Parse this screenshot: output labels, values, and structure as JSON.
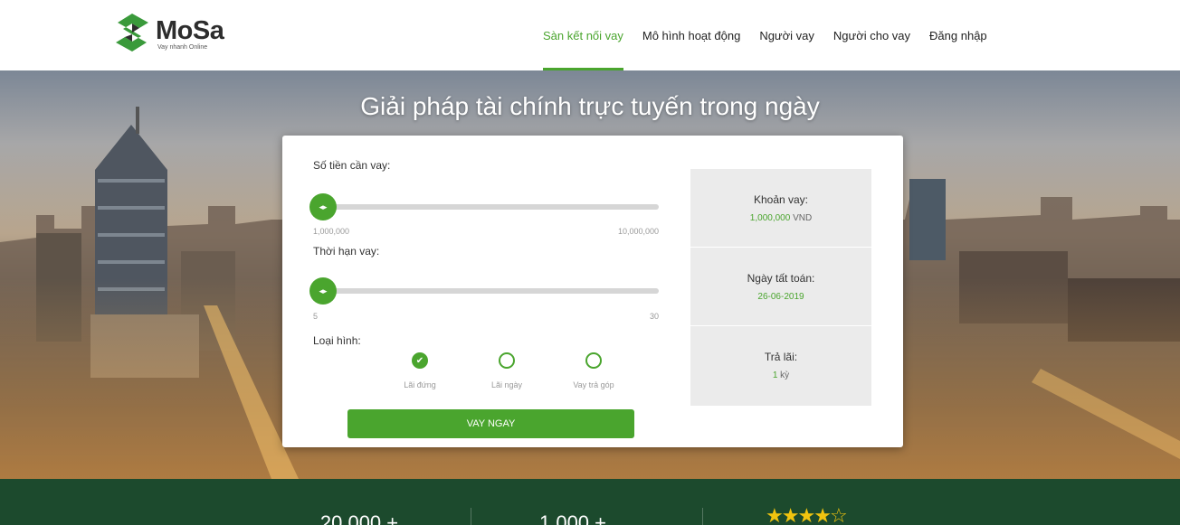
{
  "brand": {
    "name": "MoSa",
    "tagline": "Vay nhanh Online",
    "colors": {
      "primary": "#4aa52e",
      "dark": "#1c4a2d"
    }
  },
  "nav": {
    "items": [
      {
        "label": "Sàn kết nối vay",
        "active": true
      },
      {
        "label": "Mô hình hoạt động",
        "active": false
      },
      {
        "label": "Người vay",
        "active": false
      },
      {
        "label": "Người cho vay",
        "active": false
      },
      {
        "label": "Đăng nhập",
        "active": false
      }
    ]
  },
  "hero": {
    "title": "Giải pháp tài chính trực tuyến trong ngày"
  },
  "loan_form": {
    "amount": {
      "label": "Số tiền cần vay:",
      "min": "1,000,000",
      "max": "10,000,000",
      "value_fraction": 0
    },
    "term": {
      "label": "Thời hạn vay:",
      "min": "5",
      "max": "30",
      "value_fraction": 0
    },
    "type": {
      "label": "Loại hình:",
      "options": [
        {
          "label": "Lãi đứng",
          "checked": true
        },
        {
          "label": "Lãi ngày",
          "checked": false
        },
        {
          "label": "Vay trả góp",
          "checked": false
        }
      ]
    },
    "submit_label": "VAY NGAY"
  },
  "summary": {
    "loan": {
      "label": "Khoản vay:",
      "value": "1,000,000",
      "unit": "VND"
    },
    "settle": {
      "label": "Ngày tất toán:",
      "value": "26-06-2019"
    },
    "interest": {
      "label": "Trả lãi:",
      "value": "1",
      "unit": "kỳ"
    }
  },
  "stats": {
    "items": [
      {
        "value": "20.000 +"
      },
      {
        "value": "1.000 +"
      }
    ],
    "rating": {
      "stars_filled": 4,
      "stars_total": 5
    }
  }
}
